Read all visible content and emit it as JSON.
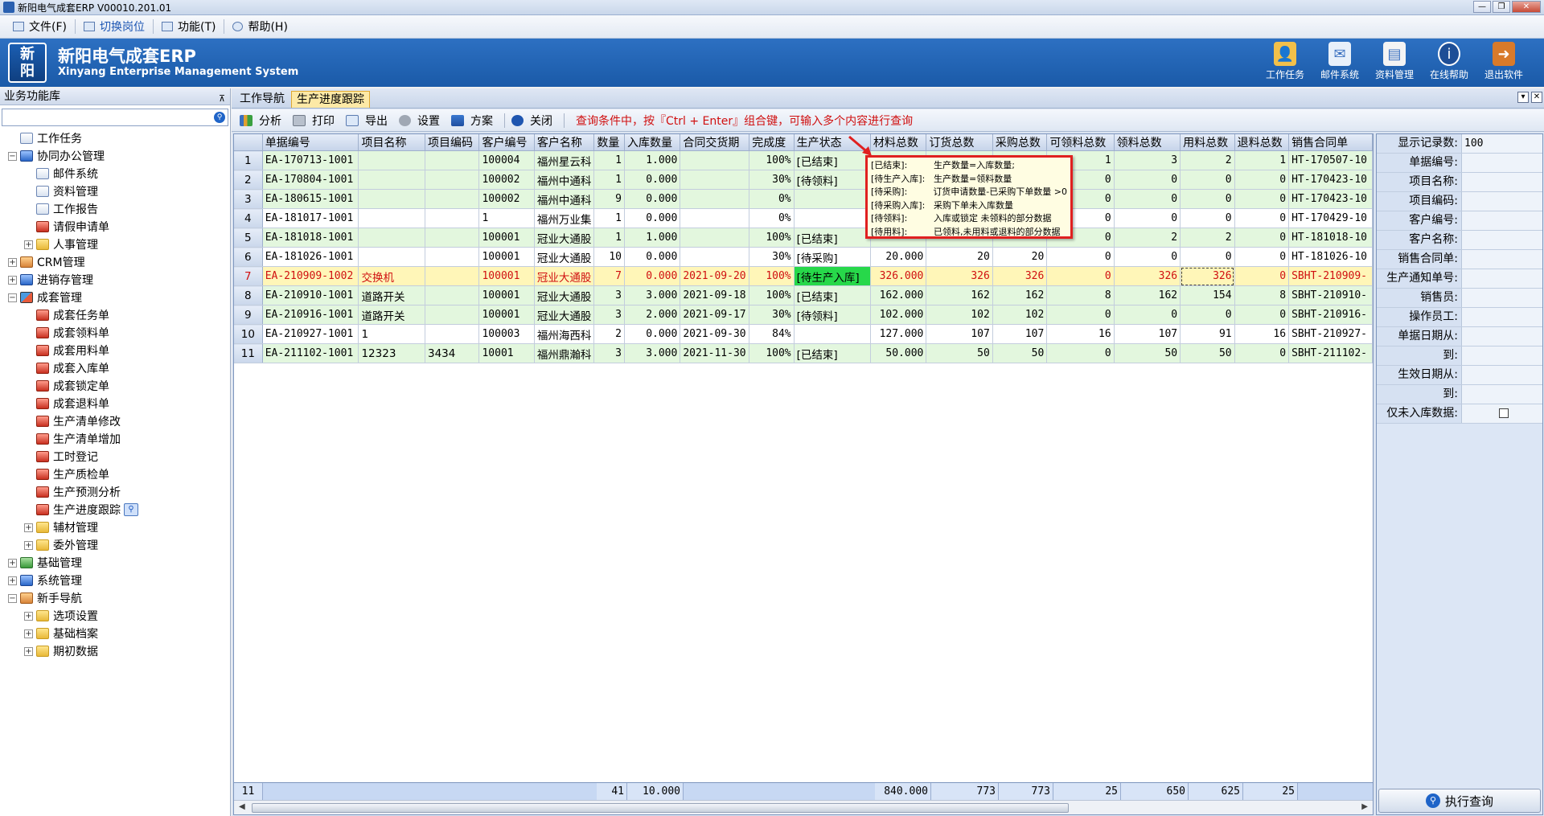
{
  "window": {
    "title": "新阳电气成套ERP V00010.201.01"
  },
  "menu": {
    "file": "文件(F)",
    "switch": "切换岗位",
    "function": "功能(T)",
    "help": "帮助(H)"
  },
  "header": {
    "logo_top": "新",
    "logo_bottom": "阳",
    "title": "新阳电气成套ERP",
    "subtitle": "Xinyang Enterprise Management System",
    "tools": [
      {
        "label": "工作任务",
        "icon": "task-person-icon"
      },
      {
        "label": "邮件系统",
        "icon": "mail-icon"
      },
      {
        "label": "资料管理",
        "icon": "document-icon"
      },
      {
        "label": "在线帮助",
        "icon": "info-icon"
      },
      {
        "label": "退出软件",
        "icon": "exit-icon"
      }
    ]
  },
  "sidebar": {
    "title": "业务功能库",
    "pin": "⊼",
    "items": [
      {
        "label": "工作任务",
        "level": 0,
        "exp": "",
        "icon": "ic-doc"
      },
      {
        "label": "协同办公管理",
        "level": 0,
        "exp": "-",
        "icon": "ic-blue"
      },
      {
        "label": "邮件系统",
        "level": 1,
        "exp": "",
        "icon": "ic-doc"
      },
      {
        "label": "资料管理",
        "level": 1,
        "exp": "",
        "icon": "ic-doc"
      },
      {
        "label": "工作报告",
        "level": 1,
        "exp": "",
        "icon": "ic-doc"
      },
      {
        "label": "请假申请单",
        "level": 1,
        "exp": "",
        "icon": "ic-red"
      },
      {
        "label": "人事管理",
        "level": 1,
        "exp": "+",
        "icon": "ic-folder"
      },
      {
        "label": "CRM管理",
        "level": 0,
        "exp": "+",
        "icon": "ic-person"
      },
      {
        "label": "进销存管理",
        "level": 0,
        "exp": "+",
        "icon": "ic-blue"
      },
      {
        "label": "成套管理",
        "level": 0,
        "exp": "-",
        "icon": "ic-multi"
      },
      {
        "label": "成套任务单",
        "level": 1,
        "exp": "",
        "icon": "ic-red"
      },
      {
        "label": "成套领料单",
        "level": 1,
        "exp": "",
        "icon": "ic-red"
      },
      {
        "label": "成套用料单",
        "level": 1,
        "exp": "",
        "icon": "ic-red"
      },
      {
        "label": "成套入库单",
        "level": 1,
        "exp": "",
        "icon": "ic-red"
      },
      {
        "label": "成套锁定单",
        "level": 1,
        "exp": "",
        "icon": "ic-red"
      },
      {
        "label": "成套退料单",
        "level": 1,
        "exp": "",
        "icon": "ic-red"
      },
      {
        "label": "生产清单修改",
        "level": 1,
        "exp": "",
        "icon": "ic-red"
      },
      {
        "label": "生产清单增加",
        "level": 1,
        "exp": "",
        "icon": "ic-red"
      },
      {
        "label": "工时登记",
        "level": 1,
        "exp": "",
        "icon": "ic-red"
      },
      {
        "label": "生产质检单",
        "level": 1,
        "exp": "",
        "icon": "ic-red"
      },
      {
        "label": "生产预测分析",
        "level": 1,
        "exp": "",
        "icon": "ic-red"
      },
      {
        "label": "生产进度跟踪",
        "level": 1,
        "exp": "",
        "icon": "ic-red",
        "focus": true
      },
      {
        "label": "辅材管理",
        "level": 1,
        "exp": "+",
        "icon": "ic-folder"
      },
      {
        "label": "委外管理",
        "level": 1,
        "exp": "+",
        "icon": "ic-folder"
      },
      {
        "label": "基础管理",
        "level": 0,
        "exp": "+",
        "icon": "ic-green"
      },
      {
        "label": "系统管理",
        "level": 0,
        "exp": "+",
        "icon": "ic-blue"
      },
      {
        "label": "新手导航",
        "level": 0,
        "exp": "-",
        "icon": "ic-person"
      },
      {
        "label": "选项设置",
        "level": 1,
        "exp": "+",
        "icon": "ic-folder"
      },
      {
        "label": "基础档案",
        "level": 1,
        "exp": "+",
        "icon": "ic-folder"
      },
      {
        "label": "期初数据",
        "level": 1,
        "exp": "+",
        "icon": "ic-folder"
      }
    ]
  },
  "tabs": [
    {
      "label": "工作导航",
      "active": false
    },
    {
      "label": "生产进度跟踪",
      "active": true
    }
  ],
  "toolbar": {
    "analyze": "分析",
    "print": "打印",
    "export": "导出",
    "settings": "设置",
    "scheme": "方案",
    "close": "关闭",
    "hint": "查询条件中，按『Ctrl + Enter』组合键，可输入多个内容进行查询"
  },
  "grid": {
    "columns": [
      "单据编号",
      "项目名称",
      "项目编码",
      "客户编号",
      "客户名称",
      "数量",
      "入库数量",
      "合同交货期",
      "完成度",
      "生产状态",
      "材料总数",
      "订货总数",
      "采购总数",
      "可领料总数",
      "领料总数",
      "用料总数",
      "退料总数",
      "销售合同单"
    ],
    "rows": [
      {
        "n": "1",
        "style": "green",
        "c": [
          "EA-170713-1001",
          "",
          "",
          "100004",
          "福州星云科",
          "1",
          "1.000",
          "",
          "100%",
          "[已结束]",
          "",
          "",
          "",
          "1",
          "3",
          "2",
          "1",
          "HT-170507-10"
        ]
      },
      {
        "n": "2",
        "style": "green",
        "c": [
          "EA-170804-1001",
          "",
          "",
          "100002",
          "福州中通科",
          "1",
          "0.000",
          "",
          "30%",
          "[待领料]",
          "",
          "",
          "",
          "0",
          "0",
          "0",
          "0",
          "HT-170423-10"
        ]
      },
      {
        "n": "3",
        "style": "green",
        "c": [
          "EA-180615-1001",
          "",
          "",
          "100002",
          "福州中通科",
          "9",
          "0.000",
          "",
          "0%",
          "",
          "",
          "",
          "",
          "0",
          "0",
          "0",
          "0",
          "HT-170423-10"
        ]
      },
      {
        "n": "4",
        "style": "white",
        "c": [
          "EA-181017-1001",
          "",
          "",
          "1",
          "福州万业集",
          "1",
          "0.000",
          "",
          "0%",
          "",
          "",
          "",
          "",
          "0",
          "0",
          "0",
          "0",
          "HT-170429-10"
        ]
      },
      {
        "n": "5",
        "style": "green",
        "c": [
          "EA-181018-1001",
          "",
          "",
          "100001",
          "冠业大通股",
          "1",
          "1.000",
          "",
          "100%",
          "[已结束]",
          "",
          "",
          "",
          "0",
          "2",
          "2",
          "0",
          "HT-181018-10"
        ]
      },
      {
        "n": "6",
        "style": "white",
        "c": [
          "EA-181026-1001",
          "",
          "",
          "100001",
          "冠业大通股",
          "10",
          "0.000",
          "",
          "30%",
          "[待采购]",
          "20.000",
          "20",
          "20",
          "0",
          "0",
          "0",
          "0",
          "HT-181026-10"
        ]
      },
      {
        "n": "7",
        "style": "sel",
        "c": [
          "EA-210909-1002",
          "交换机",
          "",
          "100001",
          "冠业大通股",
          "7",
          "0.000",
          "2021-09-20",
          "100%",
          "[待生产入库]",
          "326.000",
          "326",
          "326",
          "0",
          "326",
          "326",
          "0",
          "SBHT-210909-"
        ]
      },
      {
        "n": "8",
        "style": "green",
        "c": [
          "EA-210910-1001",
          "道路开关",
          "",
          "100001",
          "冠业大通股",
          "3",
          "3.000",
          "2021-09-18",
          "100%",
          "[已结束]",
          "162.000",
          "162",
          "162",
          "8",
          "162",
          "154",
          "8",
          "SBHT-210910-"
        ]
      },
      {
        "n": "9",
        "style": "green",
        "c": [
          "EA-210916-1001",
          "道路开关",
          "",
          "100001",
          "冠业大通股",
          "3",
          "2.000",
          "2021-09-17",
          "30%",
          "[待领料]",
          "102.000",
          "102",
          "102",
          "0",
          "0",
          "0",
          "0",
          "SBHT-210916-"
        ]
      },
      {
        "n": "10",
        "style": "white",
        "c": [
          "EA-210927-1001",
          "1",
          "",
          "100003",
          "福州海西科",
          "2",
          "0.000",
          "2021-09-30",
          "84%",
          "",
          "127.000",
          "107",
          "107",
          "16",
          "107",
          "91",
          "16",
          "SBHT-210927-"
        ]
      },
      {
        "n": "11",
        "style": "green",
        "c": [
          "EA-211102-1001",
          "12323",
          "3434",
          "10001",
          "福州鼎瀚科",
          "3",
          "3.000",
          "2021-11-30",
          "100%",
          "[已结束]",
          "50.000",
          "50",
          "50",
          "0",
          "50",
          "50",
          "0",
          "SBHT-211102-"
        ]
      }
    ],
    "footer": {
      "count": "11",
      "qty": "41",
      "in_qty": "10.000",
      "material": "840.000",
      "order": "773",
      "purchase": "773",
      "can_pick": "25",
      "picked": "650",
      "used": "625",
      "returned": "25"
    }
  },
  "tooltip": {
    "rows": [
      {
        "k": "[已结束]:",
        "v": "生产数量=入库数量;"
      },
      {
        "k": "[待生产入库]:",
        "v": "生产数量=领料数量"
      },
      {
        "k": "[待采购]:",
        "v": "订货申请数量-已采购下单数量 >0"
      },
      {
        "k": "[待采购入库]:",
        "v": "采购下单未入库数量"
      },
      {
        "k": "[待领料]:",
        "v": "入库或锁定 未领料的部分数据"
      },
      {
        "k": "[待用料]:",
        "v": "已领料,未用料或退料的部分数据"
      }
    ]
  },
  "query": {
    "fields": [
      {
        "label": "显示记录数:",
        "value": "100"
      },
      {
        "label": "单据编号:",
        "value": ""
      },
      {
        "label": "项目名称:",
        "value": ""
      },
      {
        "label": "项目编码:",
        "value": ""
      },
      {
        "label": "客户编号:",
        "value": ""
      },
      {
        "label": "客户名称:",
        "value": ""
      },
      {
        "label": "销售合同单:",
        "value": ""
      },
      {
        "label": "生产通知单号:",
        "value": ""
      },
      {
        "label": "销售员:",
        "value": ""
      },
      {
        "label": "操作员工:",
        "value": ""
      },
      {
        "label": "单据日期从:",
        "value": ""
      },
      {
        "label": "到:",
        "value": ""
      },
      {
        "label": "生效日期从:",
        "value": ""
      },
      {
        "label": "到:",
        "value": ""
      }
    ],
    "checkbox_label": "仅未入库数据:",
    "button": "执行查询"
  }
}
